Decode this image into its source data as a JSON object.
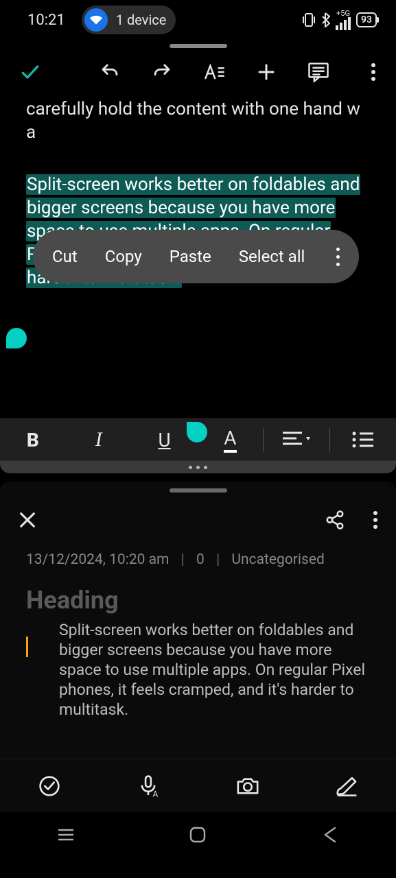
{
  "status": {
    "time": "10:21",
    "device_label": "1 device",
    "battery": "93"
  },
  "context_menu": {
    "cut": "Cut",
    "copy": "Copy",
    "paste": "Paste",
    "select_all": "Select all"
  },
  "editor": {
    "partial_text": "carefully hold the content with one hand w\na",
    "selected_text": "Split-screen works better on foldables and bigger screens because you have more space to use multiple apps. On regular Pixel phones, it feels cramped, and it's harder to multitask."
  },
  "note": {
    "meta_datetime": "13/12/2024, 10:20 am",
    "meta_count": "0",
    "meta_category": "Uncategorised",
    "heading_placeholder": "Heading",
    "body": "Split-screen works better on foldables and bigger screens because you have more space to use multiple apps. On regular Pixel phones, it feels cramped, and it's harder to multitask."
  }
}
